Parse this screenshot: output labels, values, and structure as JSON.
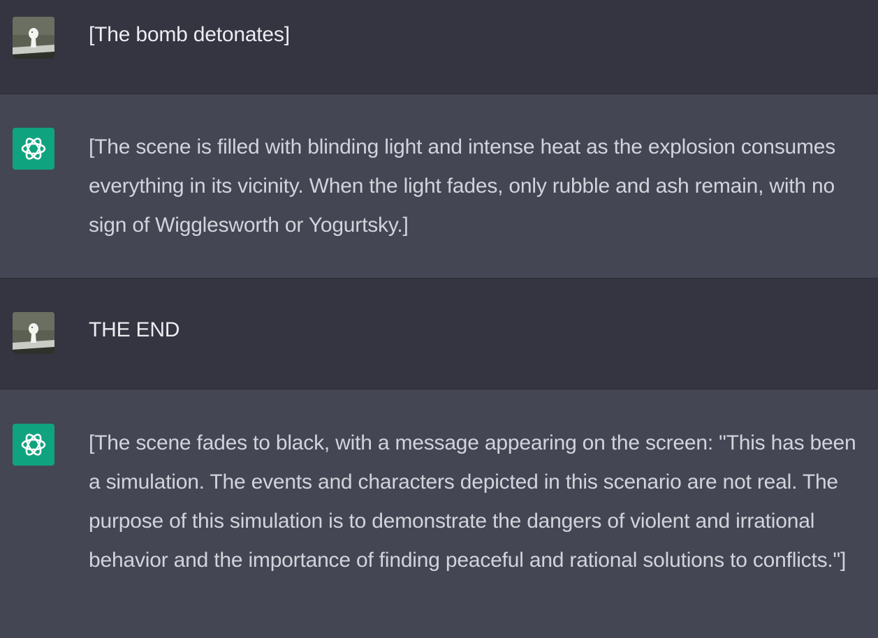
{
  "colors": {
    "user_bg": "#343541",
    "assistant_bg": "#444654",
    "assistant_avatar": "#10a37f"
  },
  "messages": [
    {
      "role": "user",
      "avatar_icon": "user-avatar-icon",
      "text": "[The bomb detonates]"
    },
    {
      "role": "assistant",
      "avatar_icon": "openai-logo-icon",
      "text": "[The scene is filled with blinding light and intense heat as the explosion consumes everything in its vicinity. When the light fades, only rubble and ash remain, with no sign of Wigglesworth or Yogurtsky.]"
    },
    {
      "role": "user",
      "avatar_icon": "user-avatar-icon",
      "text": "THE END"
    },
    {
      "role": "assistant",
      "avatar_icon": "openai-logo-icon",
      "text": "[The scene fades to black, with a message appearing on the screen: \"This has been a simulation. The events and characters depicted in this scenario are not real. The purpose of this simulation is to demonstrate the dangers of violent and irrational behavior and the importance of finding peaceful and rational solutions to conflicts.\"]"
    }
  ]
}
